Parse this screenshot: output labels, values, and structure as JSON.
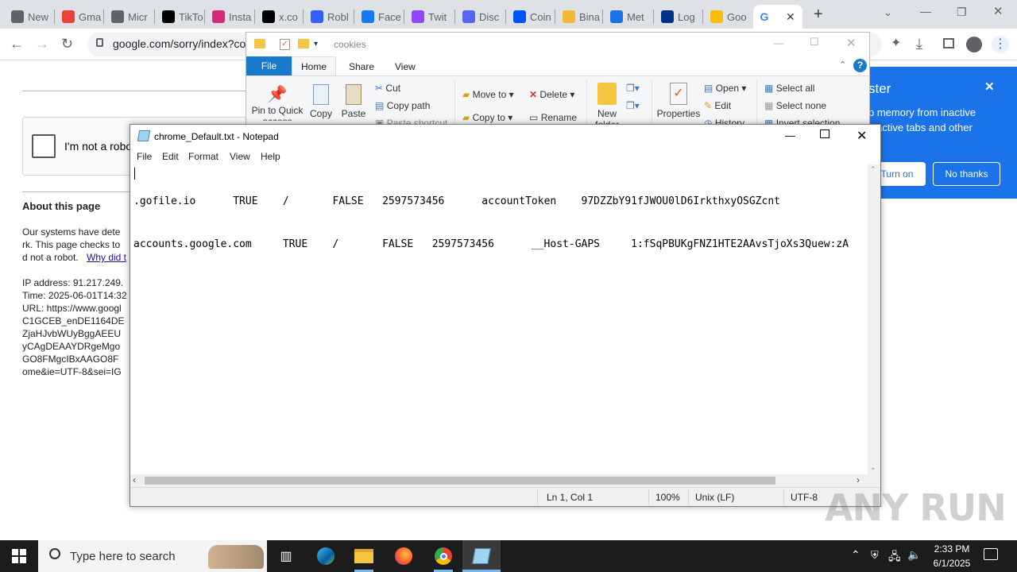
{
  "chrome": {
    "tabs": [
      {
        "label": "New",
        "color": "#5f6368"
      },
      {
        "label": "Gma",
        "color": "#ea4335"
      },
      {
        "label": "Micr",
        "color": "#5f6368"
      },
      {
        "label": "TikTo",
        "color": "#000000"
      },
      {
        "label": "Insta",
        "color": "#d62976"
      },
      {
        "label": "x.co",
        "color": "#000000"
      },
      {
        "label": "Robl",
        "color": "#335fff"
      },
      {
        "label": "Face",
        "color": "#1877f2"
      },
      {
        "label": "Twit",
        "color": "#9146ff"
      },
      {
        "label": "Disc",
        "color": "#5865f2"
      },
      {
        "label": "Coin",
        "color": "#0052ff"
      },
      {
        "label": "Bina",
        "color": "#f3ba2f"
      },
      {
        "label": "Met",
        "color": "#1a73e8"
      },
      {
        "label": "Log",
        "color": "#003087"
      },
      {
        "label": "Goo",
        "color": "#fbbc05"
      }
    ],
    "active_tab_icon": "G",
    "url": "google.com/sorry/index?cor",
    "popup": {
      "title": "ster",
      "body_line1": "p memory from inactive",
      "body_line2": "y active tabs and other",
      "turn_on": "Turn on",
      "no_thanks": "No thanks"
    }
  },
  "page": {
    "captcha_label": "I'm not a robo",
    "about_heading": "About this page",
    "lines": [
      "Our systems have dete",
      "rk. This page checks to",
      "d not a robot.",
      "IP address: 91.217.249.",
      "Time: 2025-06-01T14:32",
      "URL: https://www.googl",
      "C1GCEB_enDE1164DE",
      "ZjaHJvbWUyBggAEEU",
      "yCAgDEAAYDRgeMgo",
      "GO8FMgcIBxAAGO8F",
      "ome&ie=UTF-8&sei=IG"
    ],
    "why_link": "Why did t"
  },
  "explorer": {
    "title": "cookies",
    "tabs": {
      "file": "File",
      "home": "Home",
      "share": "Share",
      "view": "View"
    },
    "ribbon": {
      "pin": "Pin to Quick",
      "pin2": "access",
      "copy": "Copy",
      "paste": "Paste",
      "cut": "Cut",
      "copy_path": "Copy path",
      "paste_shortcut": "Paste shortcut",
      "move_to": "Move to",
      "copy_to": "Copy to",
      "delete": "Delete",
      "rename": "Rename",
      "new_folder": "New",
      "new_folder2": "folder",
      "properties": "Properties",
      "open": "Open",
      "edit": "Edit",
      "history": "History",
      "select_all": "Select all",
      "select_none": "Select none",
      "invert_selection": "Invert selection"
    }
  },
  "notepad": {
    "title": "chrome_Default.txt - Notepad",
    "menu": {
      "file": "File",
      "edit": "Edit",
      "format": "Format",
      "view": "View",
      "help": "Help"
    },
    "lines": [
      ".gofile.io\tTRUE\t/\tFALSE\t2597573456\taccountToken\t97DZZbY91fJWOU0lD6IrkthxyOSGZcnt",
      "accounts.google.com\tTRUE\t/\tFALSE\t2597573456\t__Host-GAPS\t1:fSqPBUKgFNZ1HTE2AAvsTjoXs3Quew:zA"
    ],
    "status": {
      "pos": "Ln 1, Col 1",
      "zoom": "100%",
      "eol": "Unix (LF)",
      "enc": "UTF-8"
    }
  },
  "taskbar": {
    "search_placeholder": "Type here to search",
    "time": "2:33 PM",
    "date": "6/1/2025"
  },
  "watermark": "ANY RUN"
}
